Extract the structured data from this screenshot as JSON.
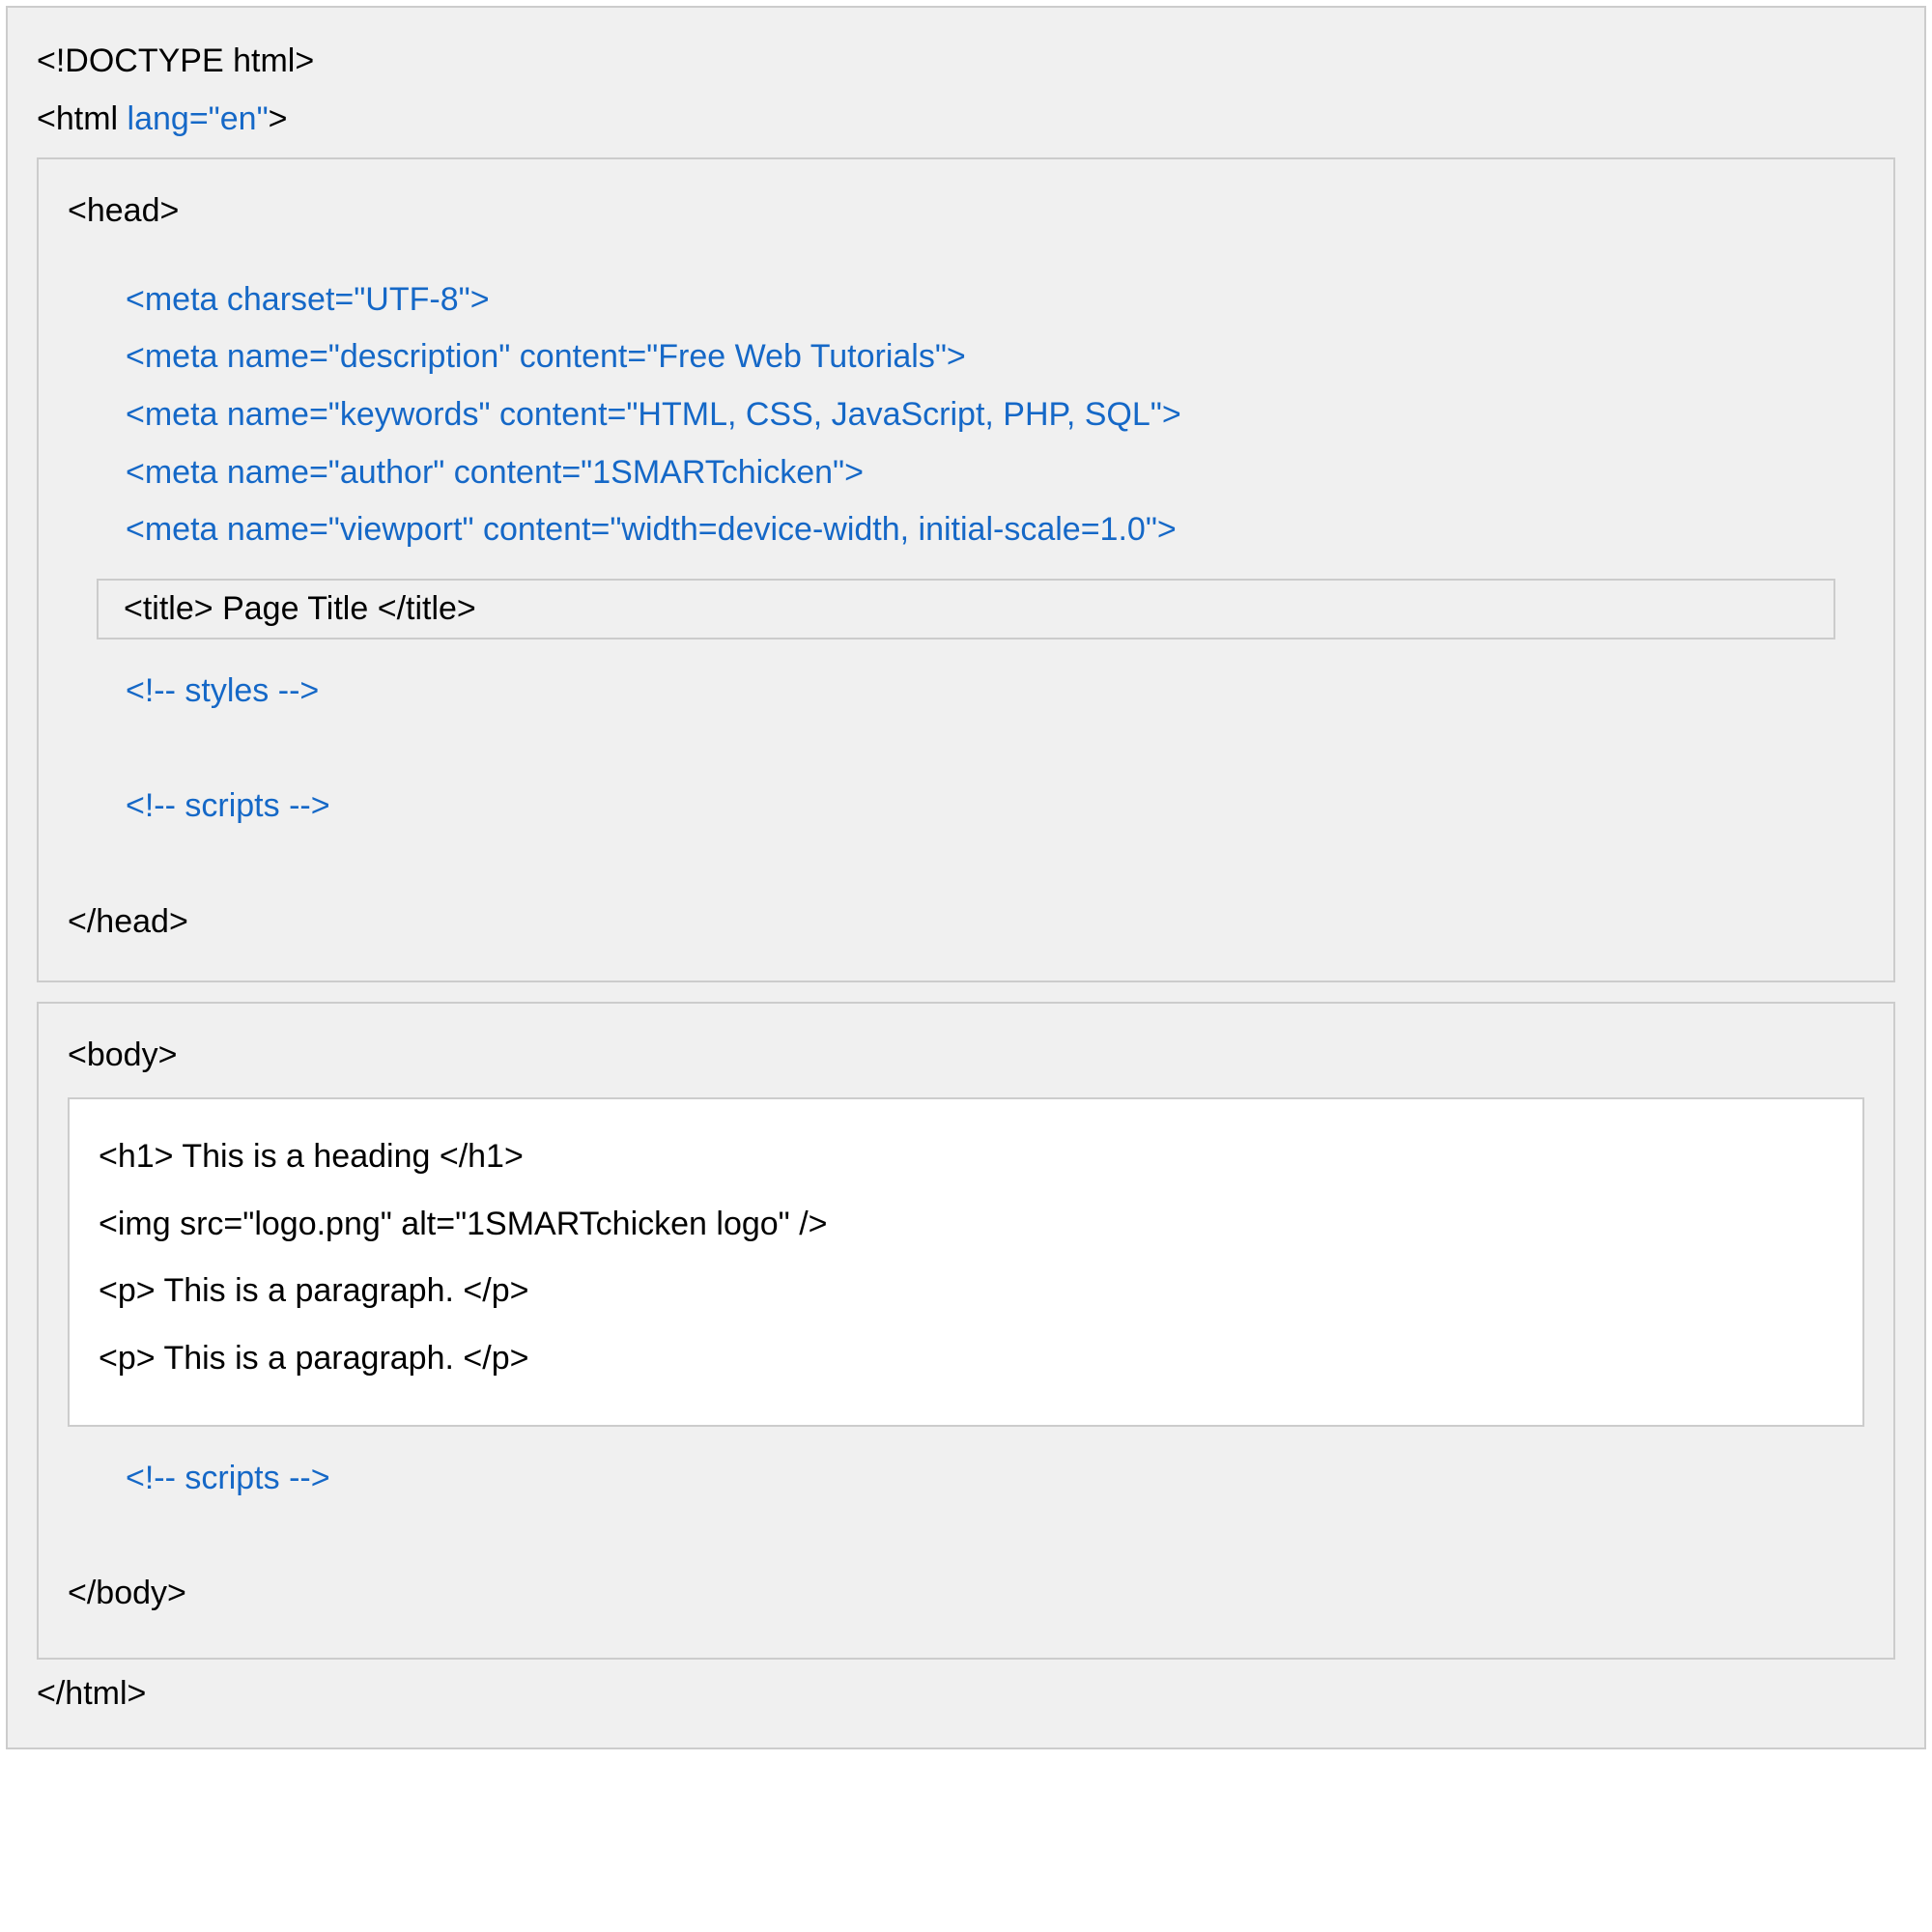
{
  "doctype_line": "<!DOCTYPE html>",
  "html_open_prefix": "<html ",
  "html_lang_attr": "lang=\"en\"",
  "html_open_suffix": ">",
  "head": {
    "open": "<head>",
    "close": "</head>",
    "meta_lines": [
      "<meta charset=\"UTF-8\">",
      "<meta name=\"description\" content=\"Free Web Tutorials\">",
      "<meta name=\"keywords\" content=\"HTML, CSS, JavaScript, PHP, SQL\">",
      "<meta name=\"author\" content=\"1SMARTchicken\">",
      "<meta name=\"viewport\" content=\"width=device-width, initial-scale=1.0\">"
    ],
    "title_line": "<title> Page Title </title>",
    "styles_comment": "<!-- styles -->",
    "scripts_comment": "<!-- scripts -->"
  },
  "body_section": {
    "open": "<body>",
    "close": "</body>",
    "content_lines": [
      "<h1> This is a heading </h1>",
      "<img src=\"logo.png\" alt=\"1SMARTchicken logo\" />",
      "<p> This is a paragraph. </p>",
      "<p> This is a paragraph. </p>"
    ],
    "scripts_comment": "<!-- scripts -->"
  },
  "html_close": "</html>"
}
